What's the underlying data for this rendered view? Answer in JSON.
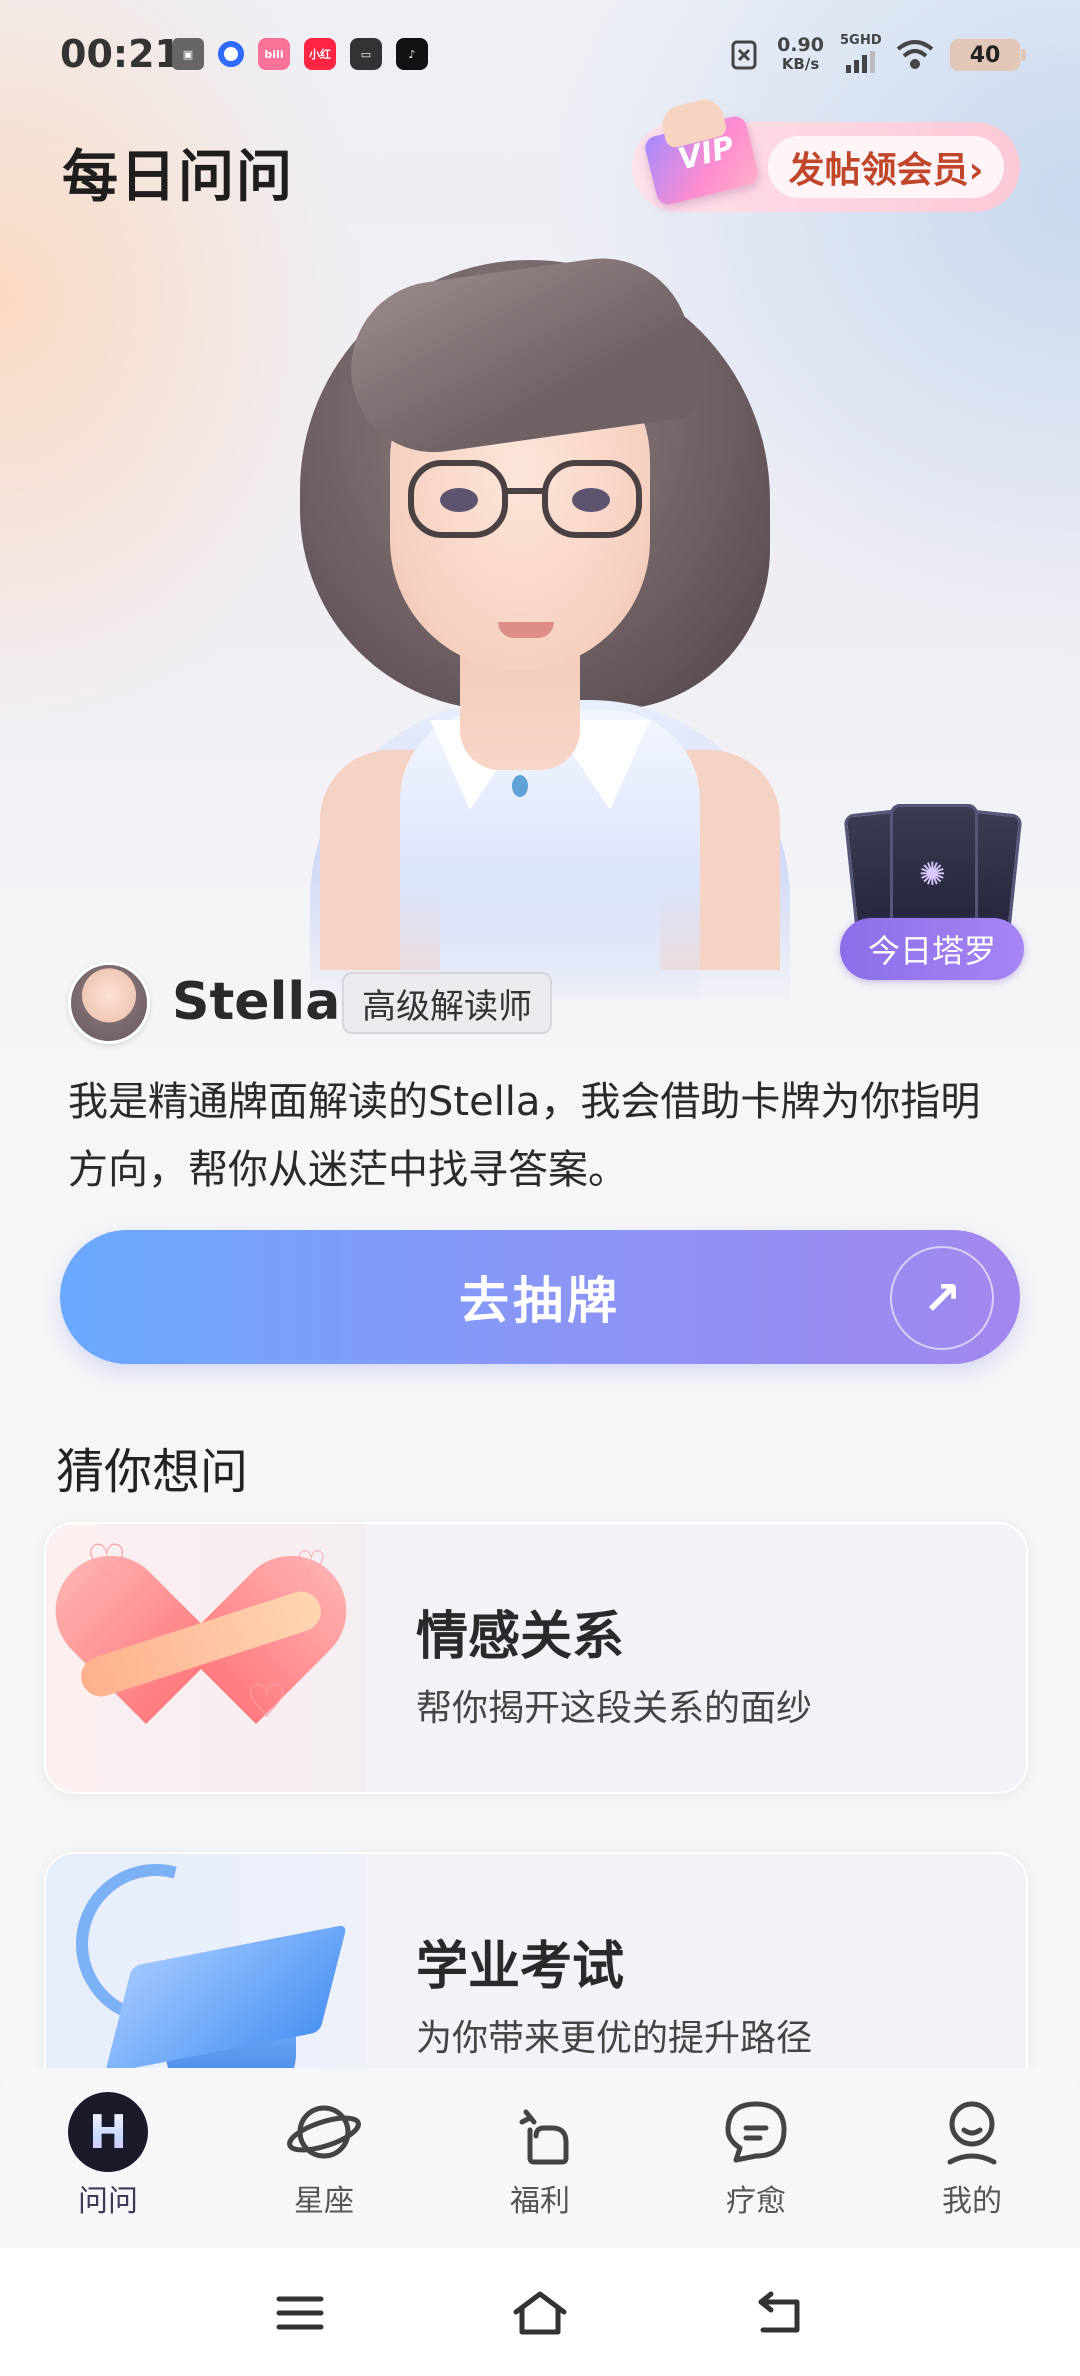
{
  "status_bar": {
    "time": "00:21",
    "net_speed_value": "0.90",
    "net_speed_unit": "KB/s",
    "network": "5G",
    "hd": "HD",
    "battery": "40",
    "app_icons": [
      {
        "name": "bilibili-tv-icon",
        "color": "#555555"
      },
      {
        "name": "browser-icon",
        "color": "#2f6bff"
      },
      {
        "name": "bilibili-icon",
        "color": "#fb7299"
      },
      {
        "name": "xiaohongshu-icon",
        "color": "#ff2442"
      },
      {
        "name": "shopping-bag-icon",
        "color": "#333333"
      },
      {
        "name": "douyin-icon",
        "color": "#111111"
      }
    ]
  },
  "header": {
    "title": "每日问问",
    "vip_badge": "VIP",
    "vip_button": "发帖领会员›"
  },
  "tarot_widget": {
    "label": "今日塔罗"
  },
  "reader": {
    "name": "Stella",
    "badge": "高级解读师",
    "intro": "我是精通牌面解读的Stella，我会借助卡牌为你指明方向，帮你从迷茫中找寻答案。"
  },
  "action": {
    "label": "去抽牌",
    "arrow": "↗"
  },
  "suggestions": {
    "title": "猜你想问",
    "items": [
      {
        "title": "情感关系",
        "desc": "帮你揭开这段关系的面纱"
      },
      {
        "title": "学业考试",
        "desc": "为你带来更优的提升路径"
      }
    ]
  },
  "bottom_nav": {
    "items": [
      {
        "label": "问问",
        "icon": "h-logo-icon",
        "active": true
      },
      {
        "label": "星座",
        "icon": "planet-icon"
      },
      {
        "label": "福利",
        "icon": "gift-icon"
      },
      {
        "label": "疗愈",
        "icon": "chat-bubble-icon"
      },
      {
        "label": "我的",
        "icon": "person-icon"
      }
    ]
  },
  "colors": {
    "accent_start": "#6aa9ff",
    "accent_end": "#a287ee",
    "tarot_purple": "#8b6ee8",
    "vip_text": "#c0462b"
  }
}
